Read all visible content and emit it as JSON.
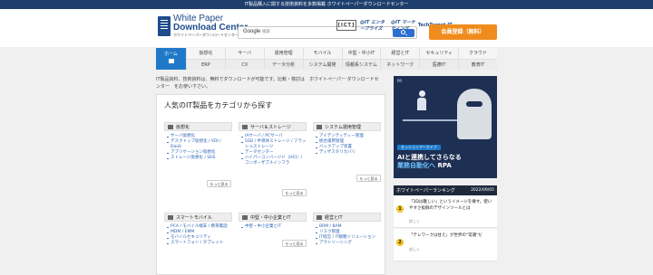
{
  "topbar": {
    "text": "IT製品購入に関する技術資料を多数掲載 ホワイトペーパーダウンロードセンター"
  },
  "logo": {
    "line1": "White Paper",
    "line2": "Download Center",
    "line3": "ホワイトペーパーダウンロードセンター"
  },
  "search": {
    "google_label": "Google",
    "placeholder": "検索"
  },
  "badges": [
    "[ICT]",
    "@IT エンタープライズ",
    "@IT マーケティング",
    "TechTarget",
    "IT"
  ],
  "register_button": "会員登録（無料）",
  "nav": {
    "home": "ホーム",
    "columns": [
      [
        "仮想化",
        "ERP"
      ],
      [
        "サーバ",
        "CX"
      ],
      [
        "運用管理",
        "データ分析"
      ],
      [
        "モバイル",
        "システム開発"
      ],
      [
        "中堅・中小IT",
        "情報系システム"
      ],
      [
        "経営とIT",
        "ネットワーク"
      ],
      [
        "セキュリティ",
        "医療IT"
      ],
      [
        "クラウド",
        "教育IT"
      ]
    ]
  },
  "intro": "IT製品資料、技術資料は、無料でダウンロードが可能です。比較・検討は　ホワイトペーパー ダウンロードセンター　をお使い下さい。",
  "main": {
    "title": "人気のIT製品をカテゴリから探す",
    "more_label": "もっと見る",
    "categories": [
      {
        "title": "仮想化",
        "items": [
          "サーバ仮想化",
          "デスクトップ仮想化 / VDI / DaaS",
          "アプリケーション仮想化",
          "ストレージ仮想化 / SDS"
        ]
      },
      {
        "title": "サーバ＆ストレージ",
        "items": [
          "IAサーバ / PCサーバ",
          "SSD / 半導体ストレージ / フラッシュストレージ",
          "データセンター",
          "ハイパーコンバージド（HCI）/ コンポーザブルインフラ"
        ]
      },
      {
        "title": "システム運用管理",
        "items": [
          "アイデンティティー管理",
          "統合運用管理",
          "バックアップ装置",
          "ディザスタリカバリ"
        ]
      },
      {
        "title": "スマートモバイル",
        "items": [
          "PCA / モバイル端末 / 携帯電話",
          "MDM / EMM",
          "モバイルセキュリティ",
          "スマートフォン / タブレット"
        ]
      },
      {
        "title": "中堅・中小企業とIT",
        "items": [
          "中堅・中小企業とIT"
        ]
      },
      {
        "title": "経営とIT",
        "items": [
          "BRM / BAM",
          "リスク管理",
          "IT経営 / IT戦略ソリューション",
          "アウトソーシング"
        ]
      }
    ]
  },
  "banner": {
    "top_text": "PR",
    "tag": "セッションアーカイブ",
    "line1": "AIと連携してさらなる",
    "line2_hl": "業務自動化へ",
    "line2_end": "RPA"
  },
  "ranking": {
    "title": "ホワイトペーパーランキング",
    "date": "2022/09/05",
    "items": [
      {
        "rank": "1",
        "text": "「3Dは難しい」というイメージを壊す。使いやすさ抜群のデザインツールとは",
        "sub": "詳しく"
      },
      {
        "rank": "2",
        "text": "「テレワークは甘え」が世界の\"常識\"だ",
        "sub": "詳しく"
      }
    ]
  }
}
